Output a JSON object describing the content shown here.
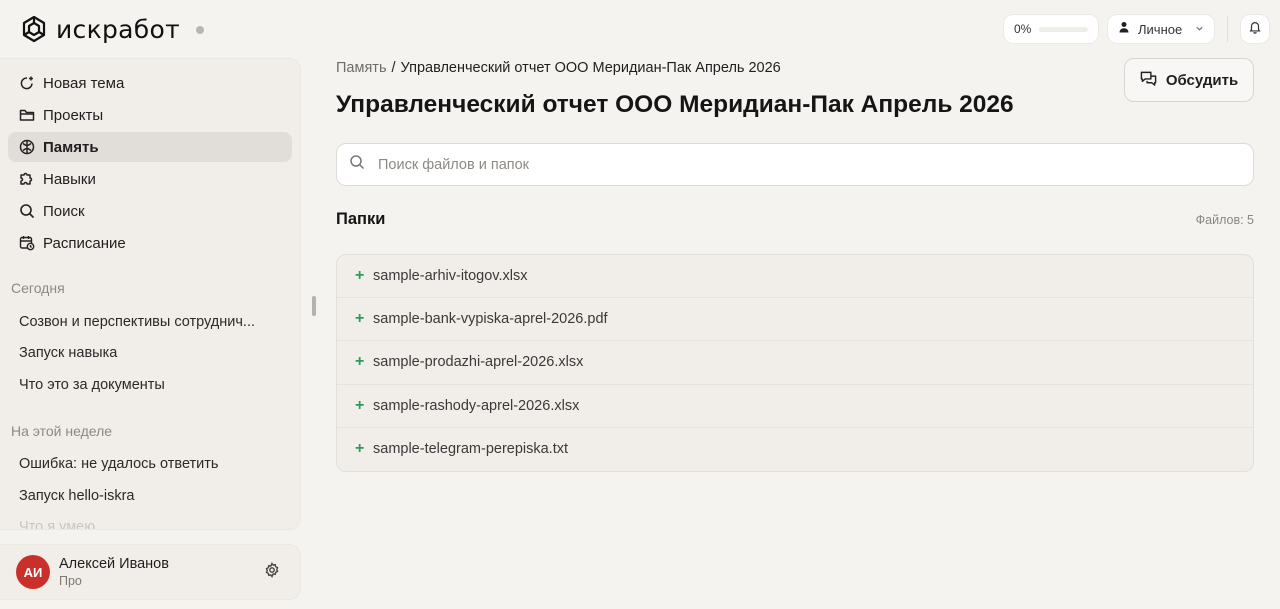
{
  "app": {
    "logo_text": "искработ"
  },
  "topbar": {
    "progress_label": "0%",
    "progress_value": 0,
    "account_label": "Личное"
  },
  "sidebar": {
    "nav": [
      {
        "label": "Новая тема",
        "icon": "new-topic-icon"
      },
      {
        "label": "Проекты",
        "icon": "folder-icon"
      },
      {
        "label": "Память",
        "icon": "memory-icon",
        "active": true
      },
      {
        "label": "Навыки",
        "icon": "puzzle-icon"
      },
      {
        "label": "Поиск",
        "icon": "search-icon"
      },
      {
        "label": "Расписание",
        "icon": "calendar-clock-icon"
      }
    ],
    "sections": [
      {
        "title": "Сегодня",
        "items": [
          "Созвон и перспективы сотруднич...",
          "Запуск навыка",
          "Что это за документы"
        ]
      },
      {
        "title": "На этой неделе",
        "items": [
          "Ошибка: не удалось ответить",
          "Запуск hello-iskra",
          "Что я умею"
        ]
      }
    ],
    "user": {
      "initials": "АИ",
      "name": "Алексей Иванов",
      "plan": "Про"
    }
  },
  "main": {
    "breadcrumb": {
      "root": "Память",
      "separator": "/",
      "current": "Управленческий отчет ООО Меридиан-Пак Апрель 2026"
    },
    "title": "Управленческий отчет ООО Меридиан-Пак Апрель 2026",
    "discuss_label": "Обсудить",
    "search_placeholder": "Поиск файлов и папок",
    "section_title": "Папки",
    "files_count": "Файлов: 5",
    "files": [
      "sample-arhiv-itogov.xlsx",
      "sample-bank-vypiska-aprel-2026.pdf",
      "sample-prodazhi-aprel-2026.xlsx",
      "sample-rashody-aprel-2026.xlsx",
      "sample-telegram-perepiska.txt"
    ]
  },
  "colors": {
    "accent_plus": "#2e9a5d",
    "avatar_bg": "#c9302c"
  }
}
